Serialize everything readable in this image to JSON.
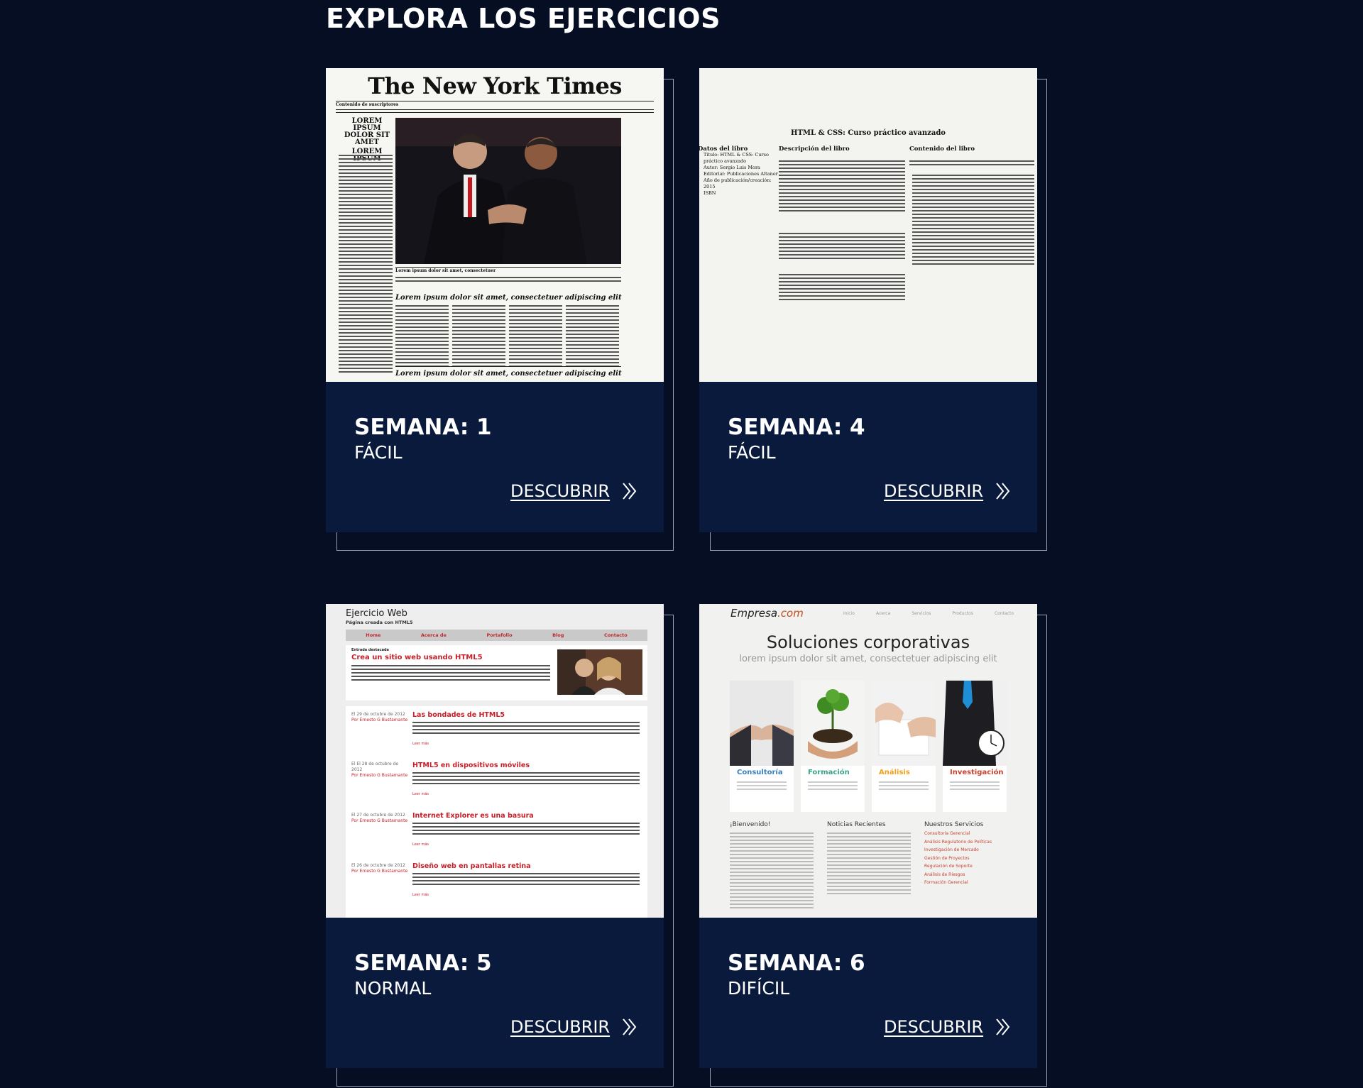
{
  "section_title": "EXPLORA LOS EJERCICIOS",
  "colors": {
    "background": "#050e22",
    "card": "#0a1a3d",
    "outline": "#9aa4b8",
    "text": "#ffffff"
  },
  "cards": [
    {
      "week_label": "SEMANA: 1",
      "level": "FÁCIL",
      "link_label": "DESCUBRIR",
      "thumbnail": {
        "masthead": "The New York Times",
        "strip": "Contenido de suscriptores",
        "side_head_1": "LOREM IPSUM DOLOR SIT AMET",
        "side_head_2": "LOREM IPSUM",
        "caption": "Lorem ipsum dolor sit amet, consectetuer",
        "feature": "Lorem ipsum dolor sit amet, consectetuer adipiscing elit",
        "feature_2": "Lorem ipsum dolor sit amet, consectetuer adipiscing elit"
      }
    },
    {
      "week_label": "SEMANA: 4",
      "level": "FÁCIL",
      "link_label": "DESCUBRIR",
      "thumbnail": {
        "title": "HTML & CSS: Curso práctico avanzado",
        "col1": "Datos del libro",
        "col2": "Descripción del libro",
        "col3": "Contenido del libro",
        "list": [
          "Título: HTML & CSS: Curso práctico avanzado",
          "Autor: Sergio Luis Mora",
          "Editorial: Publicaciones Altaner",
          "Año de publicación/creación: 2015",
          "ISBN"
        ]
      }
    },
    {
      "week_label": "SEMANA: 5",
      "level": "NORMAL",
      "link_label": "DESCUBRIR",
      "thumbnail": {
        "title": "Ejercicio Web",
        "subtitle": "Página creada con HTML5",
        "nav": [
          "Home",
          "Acerca de",
          "Portafolio",
          "Blog",
          "Contacto"
        ],
        "featured_tag": "Entrada destacada",
        "featured_title": "Crea un sitio web usando HTML5",
        "posts": [
          {
            "date": "El 29 de octubre de 2012",
            "title": "Las bondades de HTML5"
          },
          {
            "date": "El El 28 de octubre de 2012",
            "title": "HTML5 en dispositivos móviles"
          },
          {
            "date": "El 27 de octubre de 2012",
            "title": "Internet Explorer es una basura"
          },
          {
            "date": "El 26 de octubre de 2012",
            "title": "Diseño web en pantallas retina"
          }
        ],
        "author": "Por Ernesto G Bustamante",
        "read_more": "Leer más"
      }
    },
    {
      "week_label": "SEMANA: 6",
      "level": "DIFÍCIL",
      "link_label": "DESCUBRIR",
      "thumbnail": {
        "logo_main": "Empresa",
        "logo_tld": ".com",
        "nav": [
          "Inicio",
          "Acerca",
          "Servicios",
          "Productos",
          "Contacto"
        ],
        "hero": "Soluciones corporativas",
        "hero_sub": "lorem ipsum dolor sit amet, consectetuer adipiscing elit",
        "tiles": [
          "Consultoría",
          "Formación",
          "Análisis",
          "Investigación"
        ],
        "columns": [
          "¡Bienvenido!",
          "Noticias Recientes",
          "Nuestros Servicios"
        ],
        "services": [
          "Consultoría Gerencial",
          "Análisis Regulatorio de Políticas",
          "Investigación de Mercado",
          "Gestión de Proyectos",
          "Regulación de Soporte",
          "Análisis de Riesgos",
          "Formación Gerencial"
        ]
      }
    }
  ]
}
